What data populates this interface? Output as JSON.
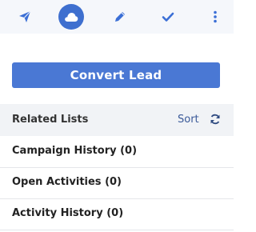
{
  "toolbar": {
    "icons": [
      "send-icon",
      "cloud-icon",
      "pencil-icon",
      "check-icon",
      "more-vertical-icon"
    ],
    "accent": "#3e6fcf",
    "icon_color": "#3b6fd6"
  },
  "convert": {
    "label": "Convert Lead",
    "color": "#4a78d4"
  },
  "related": {
    "title": "Related Lists",
    "sort_label": "Sort",
    "refresh_icon": "refresh-icon",
    "items": [
      {
        "label": "Campaign History (0)"
      },
      {
        "label": "Open Activities (0)"
      },
      {
        "label": "Activity History (0)"
      }
    ]
  }
}
